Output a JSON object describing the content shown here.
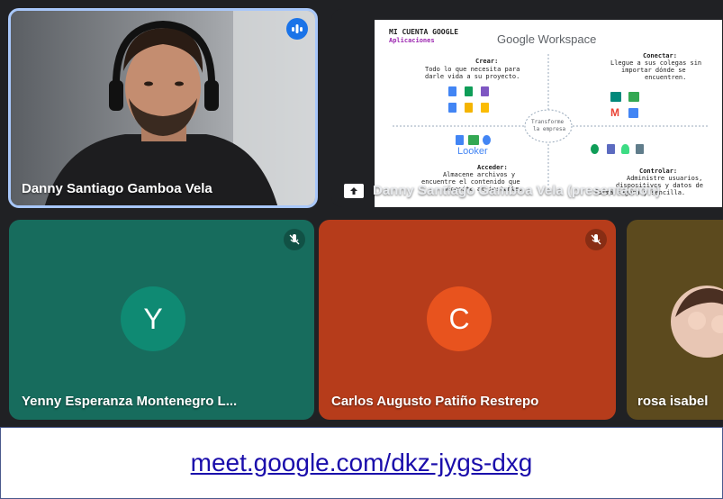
{
  "tiles": {
    "speaker": {
      "name": "Danny Santiago Gamboa Vela"
    },
    "presentation": {
      "name": "Danny Santiago Gamboa Vela (presentación)",
      "slide": {
        "title": "MI CUENTA GOOGLE",
        "subtitle": "Aplicaciones",
        "brand": "Google Workspace",
        "crear_label": "Crear:",
        "crear_text_1": "Todo lo que necesita para",
        "crear_text_2": "darle vida a su proyecto.",
        "conectar_label": "Conectar:",
        "conectar_text_1": "Llegue a sus colegas sin",
        "conectar_text_2": "importar dónde se",
        "conectar_text_3": "encuentren.",
        "center_1": "Transforme",
        "center_2": "la empresa",
        "looker": "Looker",
        "acceder_label": "Acceder:",
        "acceder_text_1": "Almacene archivos y",
        "acceder_text_2": "encuentre el contenido que",
        "acceder_text_3": "necesite al instante.",
        "controlar_label": "Controlar:",
        "controlar_text_1": "Administre usuarios,",
        "controlar_text_2": "dispositivos y datos de",
        "controlar_text_3": "forma segura y sencilla."
      }
    },
    "yenny": {
      "name": "Yenny Esperanza Montenegro L...",
      "initial": "Y",
      "bg": "#176c5d",
      "avatar_bg": "#0f8a73"
    },
    "carlos": {
      "name": "Carlos Augusto Patiño Restrepo",
      "initial": "C",
      "bg": "#b63c1b",
      "avatar_bg": "#e8531e"
    },
    "rosa": {
      "name": "rosa isabel"
    }
  },
  "footer": {
    "link": "meet.google.com/dkz-jygs-dxg"
  },
  "icons": {
    "speaking": "speaking-indicator-icon",
    "muted": "mic-off-icon",
    "present": "present-to-all-icon"
  }
}
